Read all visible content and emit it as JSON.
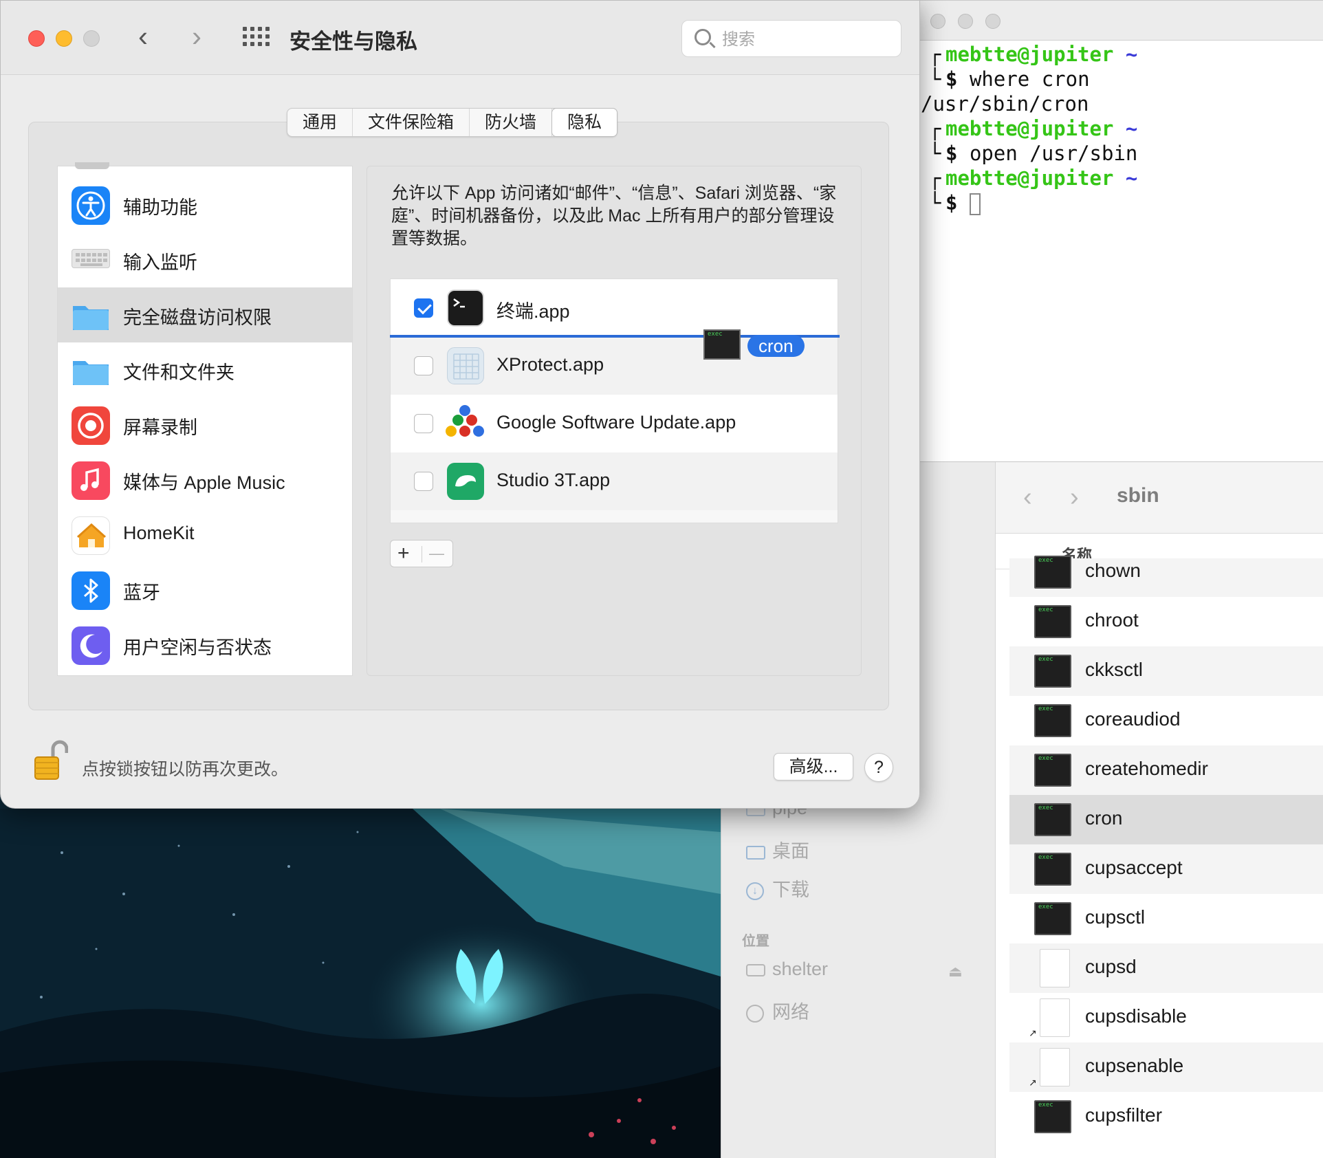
{
  "prefs": {
    "title": "安全性与隐私",
    "search_placeholder": "搜索",
    "tabs": [
      "通用",
      "文件保险箱",
      "防火墙",
      "隐私"
    ],
    "active_tab": "隐私",
    "categories": [
      {
        "label": "辅助功能",
        "icon": "accessibility-icon",
        "color": "#1a84f7"
      },
      {
        "label": "输入监听",
        "icon": "keyboard-icon",
        "color": "#d9d9d9"
      },
      {
        "label": "完全磁盘访问权限",
        "icon": "folder-icon",
        "color": "#58b3f3",
        "selected": true
      },
      {
        "label": "文件和文件夹",
        "icon": "folder-icon",
        "color": "#58b3f3"
      },
      {
        "label": "屏幕录制",
        "icon": "screen-record-icon",
        "color": "#f0463c"
      },
      {
        "label": "媒体与 Apple Music",
        "icon": "music-icon",
        "color": "#f8495f"
      },
      {
        "label": "HomeKit",
        "icon": "home-icon",
        "color": "#f5a524"
      },
      {
        "label": "蓝牙",
        "icon": "bluetooth-icon",
        "color": "#1a84f7"
      },
      {
        "label": "用户空闲与否状态",
        "icon": "moon-icon",
        "color": "#5e5ce6"
      }
    ],
    "description": "允许以下 App 访问诸如“邮件”、“信息”、Safari 浏览器、“家庭”、时间机器备份，以及此 Mac 上所有用户的部分管理设置等数据。",
    "apps": [
      {
        "name": "终端.app",
        "checked": true,
        "icon": "terminal-icon"
      },
      {
        "name": "XProtect.app",
        "checked": false,
        "icon": "xprotect-icon"
      },
      {
        "name": "Google Software Update.app",
        "checked": false,
        "icon": "google-update-icon"
      },
      {
        "name": "Studio 3T.app",
        "checked": false,
        "icon": "studio3t-icon"
      }
    ],
    "drag_label": "cron",
    "add_symbol": "+",
    "remove_symbol": "—",
    "lock_text": "点按锁按钮以防再次更改。",
    "advanced_button": "高级...",
    "help_button": "?"
  },
  "terminal": {
    "lines": [
      {
        "type": "prompt",
        "user": "mebtte@jupiter",
        "tilde": "~"
      },
      {
        "type": "cmd",
        "prefix": "$",
        "text": "where cron"
      },
      {
        "type": "out",
        "text": "/usr/sbin/cron"
      },
      {
        "type": "prompt",
        "user": "mebtte@jupiter",
        "tilde": "~"
      },
      {
        "type": "cmd",
        "prefix": "$",
        "text": "open /usr/sbin"
      },
      {
        "type": "prompt",
        "user": "mebtte@jupiter",
        "tilde": "~"
      },
      {
        "type": "cmd",
        "prefix": "$",
        "text": ""
      }
    ]
  },
  "finder": {
    "title": "sbin",
    "column_header": "名称",
    "sidebar": {
      "items_top": [
        {
          "label": "pipe",
          "icon": "folder-icon"
        },
        {
          "label": "桌面",
          "icon": "desktop-icon"
        },
        {
          "label": "下载",
          "icon": "download-icon"
        }
      ],
      "section": "位置",
      "items_bottom": [
        {
          "label": "shelter",
          "icon": "disk-icon"
        },
        {
          "label": "网络",
          "icon": "network-icon"
        }
      ]
    },
    "files": [
      {
        "name": "chown",
        "kind": "exec"
      },
      {
        "name": "chroot",
        "kind": "exec"
      },
      {
        "name": "ckksctl",
        "kind": "exec"
      },
      {
        "name": "coreaudiod",
        "kind": "exec"
      },
      {
        "name": "createhomedir",
        "kind": "exec"
      },
      {
        "name": "cron",
        "kind": "exec",
        "selected": true
      },
      {
        "name": "cupsaccept",
        "kind": "exec"
      },
      {
        "name": "cupsctl",
        "kind": "exec"
      },
      {
        "name": "cupsd",
        "kind": "doc"
      },
      {
        "name": "cupsdisable",
        "kind": "alias"
      },
      {
        "name": "cupsenable",
        "kind": "alias"
      },
      {
        "name": "cupsfilter",
        "kind": "exec"
      }
    ]
  }
}
